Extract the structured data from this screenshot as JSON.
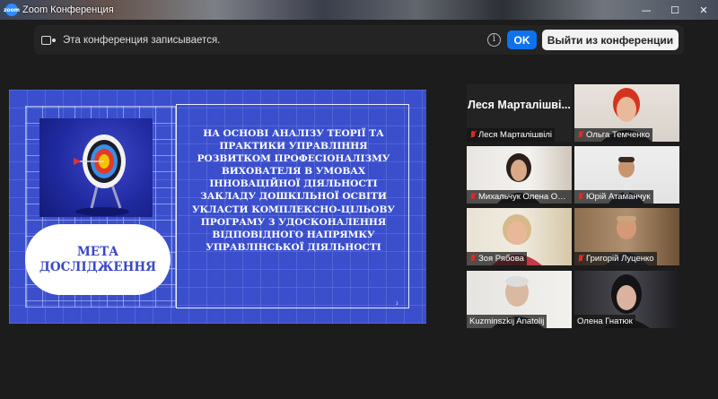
{
  "window": {
    "title": "Zoom Конференция",
    "logo_text": "zoom",
    "controls": {
      "minimize": "—",
      "maximize": "☐",
      "close": "✕"
    }
  },
  "recording_bar": {
    "message": "Эта конференция записывается.",
    "info_icon": "i",
    "ok_label": "OK",
    "leave_label": "Выйти из конференции"
  },
  "slide": {
    "pill_title": "МЕТА\nДОСЛІДЖЕННЯ",
    "body": "НА  ОСНОВІ АНАЛІЗУ ТЕОРІЇ ТА ПРАКТИКИ УПРАВЛІННЯ РОЗВИТКОМ ПРОФЕСІОНАЛІЗМУ ВИХОВАТЕЛЯ В УМОВАХ ІННОВАЦІЙНОЇ ДІЯЛЬНОСТІ ЗАКЛАДУ ДОШКІЛЬНОЇ ОСВІТИ УКЛАСТИ КОМПЛЕКСНО-ЦІЛЬОВУ ПРОГРАМУ З УДОСКОНАЛЕННЯ ВІДПОВІДНОГО НАПРЯМКУ УПРАВЛІНСЬКОЇ ДІЯЛЬНОСТІ",
    "page_number": "3"
  },
  "participants": [
    {
      "name": "Леся Марталішвілі",
      "display_name": "Леся  Марталішві...",
      "muted": true,
      "video": false
    },
    {
      "name": "Ольга Темченко",
      "muted": true,
      "video": true
    },
    {
      "name": "Михальчук Олена Ол...",
      "muted": true,
      "video": true
    },
    {
      "name": "Юрій Атаманчук",
      "muted": true,
      "video": true
    },
    {
      "name": "Зоя Рябова",
      "muted": true,
      "video": true
    },
    {
      "name": "Григорій Луценко",
      "muted": true,
      "video": true
    },
    {
      "name": "Kuzminszkij Anatolij",
      "muted": false,
      "video": true
    },
    {
      "name": "Олена Гнатюк",
      "muted": false,
      "video": true,
      "active_speaker": true
    }
  ],
  "colors": {
    "slide_bg": "#3b4fcd",
    "ok_button": "#0e72ed",
    "active_speaker_border": "#e5e53c",
    "muted_mic": "#e02828"
  }
}
